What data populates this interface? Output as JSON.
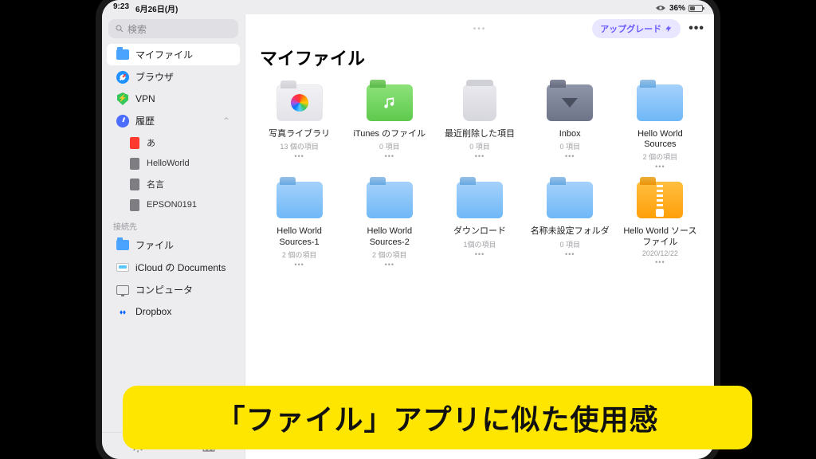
{
  "status": {
    "time": "9:23",
    "date": "6月26日(月)",
    "battery": "36%"
  },
  "search": {
    "placeholder": "検索"
  },
  "sidebar": {
    "items": [
      {
        "label": "マイファイル",
        "icon": "folder",
        "active": true
      },
      {
        "label": "ブラウザ",
        "icon": "safari"
      },
      {
        "label": "VPN",
        "icon": "shield"
      },
      {
        "label": "履歴",
        "icon": "clock",
        "expandable": true
      }
    ],
    "history": [
      {
        "label": "あ",
        "icon": "doc-red"
      },
      {
        "label": "HelloWorld",
        "icon": "doc"
      },
      {
        "label": "名言",
        "icon": "doc"
      },
      {
        "label": "EPSON0191",
        "icon": "doc"
      }
    ],
    "locations_label": "接続先",
    "locations": [
      {
        "label": "ファイル",
        "icon": "folder"
      },
      {
        "label": "iCloud の Documents",
        "icon": "drive"
      },
      {
        "label": "コンピュータ",
        "icon": "monitor"
      },
      {
        "label": "Dropbox",
        "icon": "dropbox"
      }
    ]
  },
  "topbar": {
    "upgrade": "アップグレード"
  },
  "page": {
    "title": "マイファイル"
  },
  "tiles": [
    {
      "name": "写真ライブラリ",
      "meta": "13 個の項目",
      "kind": "gray-photos"
    },
    {
      "name": "iTunes のファイル",
      "meta": "0 項目",
      "kind": "green-music"
    },
    {
      "name": "最近削除した項目",
      "meta": "0 項目",
      "kind": "trash"
    },
    {
      "name": "Inbox",
      "meta": "0 項目",
      "kind": "dark"
    },
    {
      "name": "Hello World Sources",
      "meta": "2 個の項目",
      "kind": "blue"
    },
    {
      "name": "Hello World Sources-1",
      "meta": "2 個の項目",
      "kind": "blue"
    },
    {
      "name": "Hello World Sources-2",
      "meta": "2 個の項目",
      "kind": "blue"
    },
    {
      "name": "ダウンロード",
      "meta": "1個の項目",
      "kind": "blue"
    },
    {
      "name": "名称未設定フォルダ",
      "meta": "0 項目",
      "kind": "blue"
    },
    {
      "name": "Hello World ソースファイル",
      "meta": "2020/12/22",
      "kind": "zip"
    }
  ],
  "caption": "「ファイル」アプリに似た使用感"
}
